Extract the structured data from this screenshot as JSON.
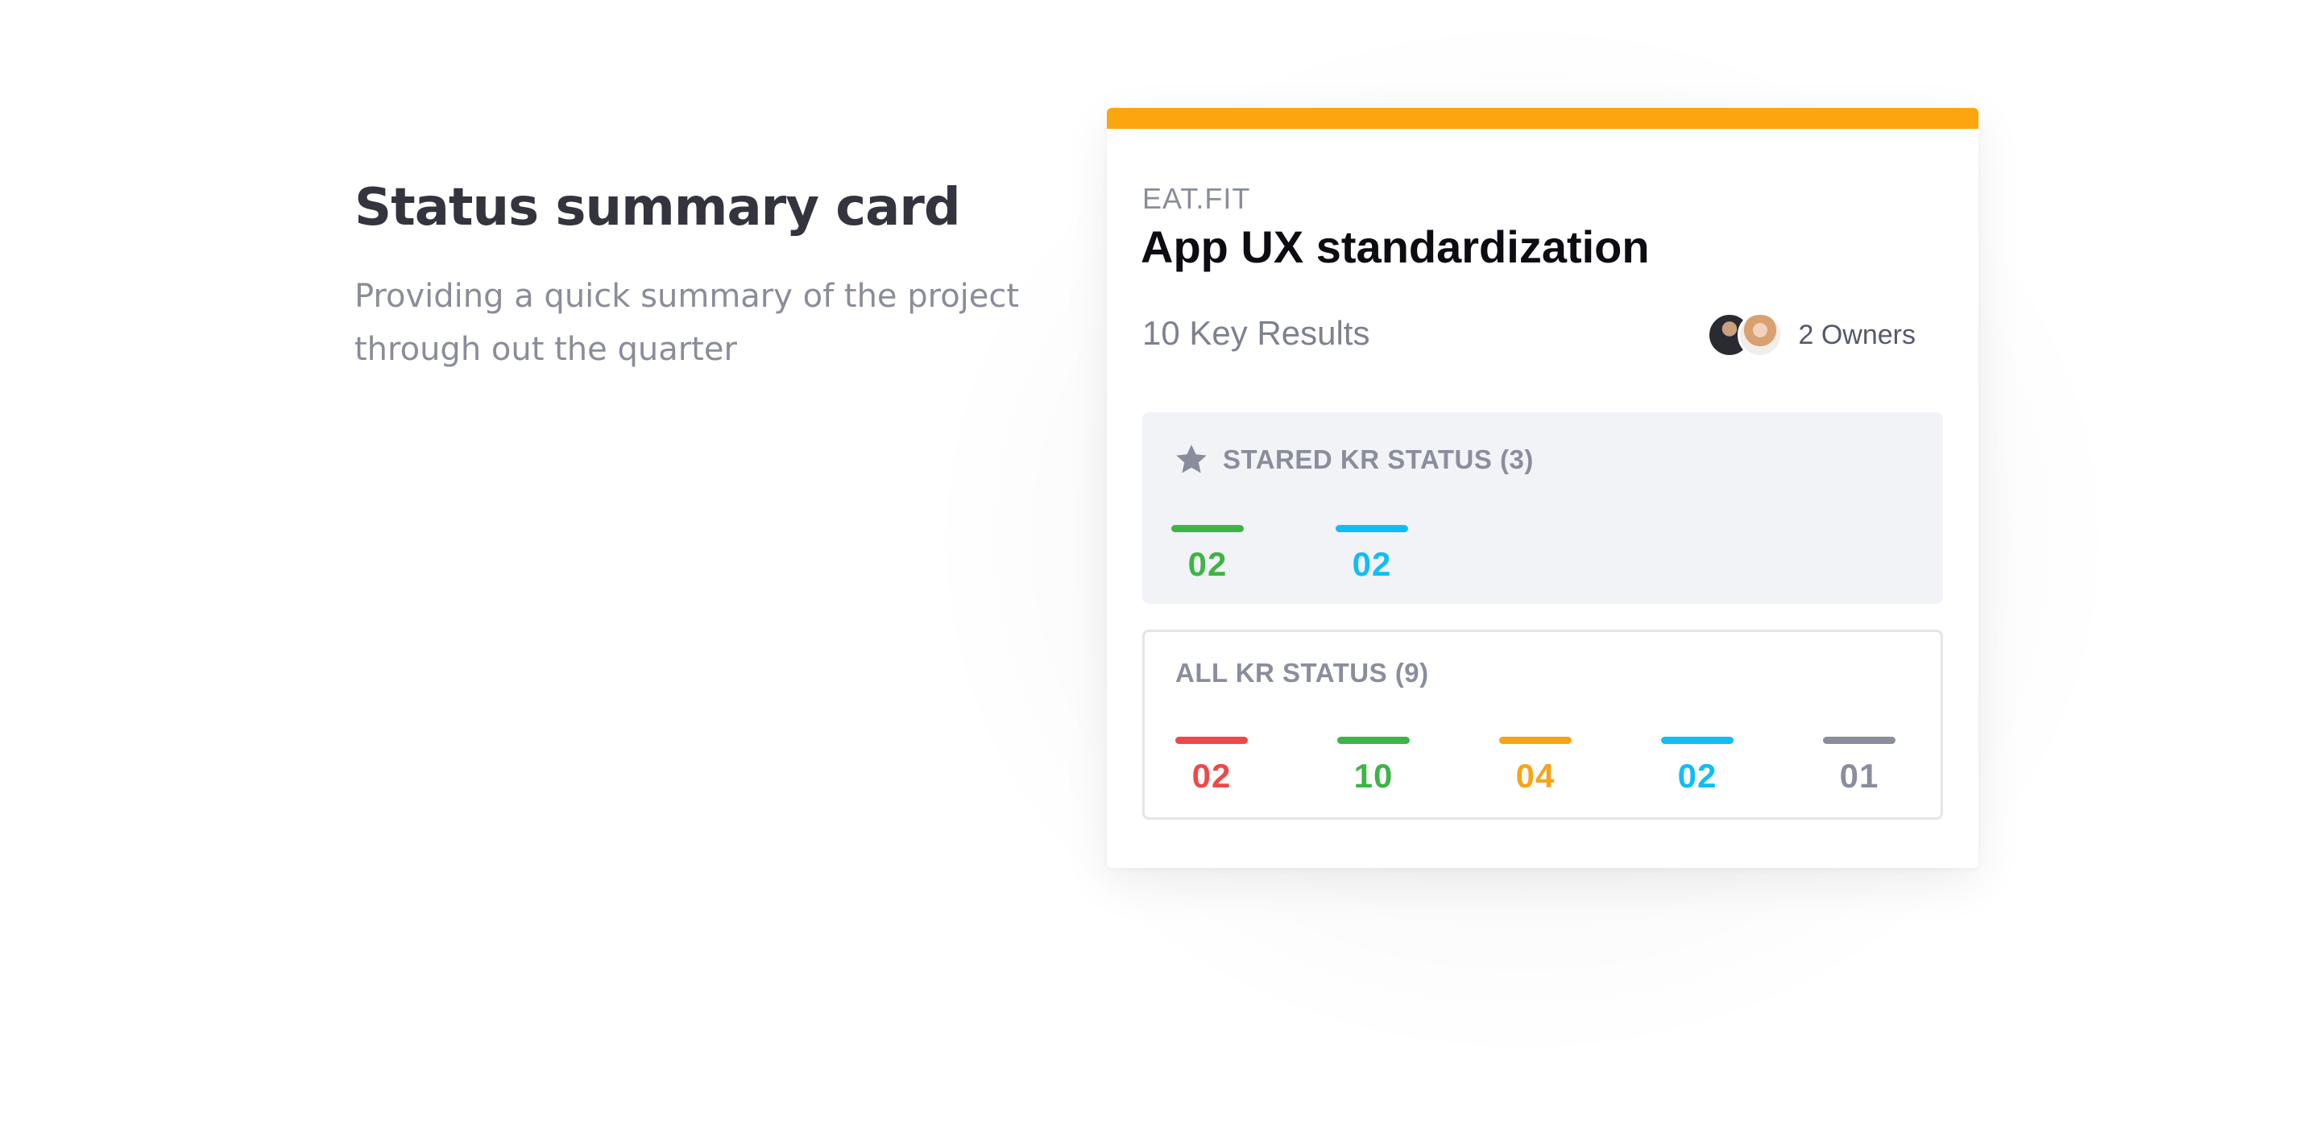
{
  "intro": {
    "title": "Status summary card",
    "subtitle": "Providing a quick summary of the project through out the quarter"
  },
  "card": {
    "accent_color": "#fda50f",
    "org": "EAT.FIT",
    "title": "App UX standardization",
    "key_results": "10 Key Results",
    "owners_label": "2 Owners",
    "starred": {
      "header": "STARED KR STATUS (3)",
      "icon": "star-icon",
      "stats": [
        {
          "value": "02",
          "color": "#3db544"
        },
        {
          "value": "02",
          "color": "#11bdf5"
        }
      ]
    },
    "all": {
      "header": "ALL KR STATUS (9)",
      "stats": [
        {
          "value": "02",
          "color": "#ef4848"
        },
        {
          "value": "10",
          "color": "#3db544"
        },
        {
          "value": "04",
          "color": "#f7a416"
        },
        {
          "value": "02",
          "color": "#11bdf5"
        },
        {
          "value": "01",
          "color": "#8a8d9c"
        }
      ]
    }
  }
}
